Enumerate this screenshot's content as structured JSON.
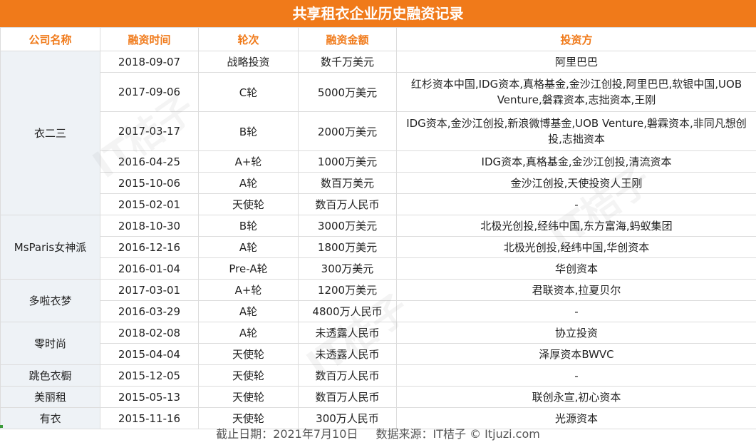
{
  "title": "共享租衣企业历史融资记录",
  "headers": [
    "公司名称",
    "融资时间",
    "轮次",
    "融资金额",
    "投资方"
  ],
  "companies": [
    {
      "name": "衣二三",
      "rows": [
        {
          "date": "2018-09-07",
          "round": "战略投资",
          "amount": "数千万美元",
          "investors": "阿里巴巴"
        },
        {
          "date": "2017-09-06",
          "round": "C轮",
          "amount": "5000万美元",
          "investors": "红杉资本中国,IDG资本,真格基金,金沙江创投,阿里巴巴,软银中国,UOB Venture,磐霖资本,志拙资本,王刚"
        },
        {
          "date": "2017-03-17",
          "round": "B轮",
          "amount": "2000万美元",
          "investors": "IDG资本,金沙江创投,新浪微博基金,UOB Venture,磐霖资本,非同凡想创投,志拙资本"
        },
        {
          "date": "2016-04-25",
          "round": "A+轮",
          "amount": "1000万美元",
          "investors": "IDG资本,真格基金,金沙江创投,清流资本"
        },
        {
          "date": "2015-10-06",
          "round": "A轮",
          "amount": "数百万美元",
          "investors": "金沙江创投,天使投资人王刚"
        },
        {
          "date": "2015-02-01",
          "round": "天使轮",
          "amount": "数百万人民币",
          "investors": "-"
        }
      ]
    },
    {
      "name": "MsParis女神派",
      "rows": [
        {
          "date": "2018-10-30",
          "round": "B轮",
          "amount": "3000万美元",
          "investors": "北极光创投,经纬中国,东方富海,蚂蚁集团"
        },
        {
          "date": "2016-12-16",
          "round": "A轮",
          "amount": "1800万美元",
          "investors": "北极光创投,经纬中国,华创资本"
        },
        {
          "date": "2016-01-04",
          "round": "Pre-A轮",
          "amount": "300万美元",
          "investors": "华创资本"
        }
      ]
    },
    {
      "name": "多啦衣梦",
      "rows": [
        {
          "date": "2017-03-01",
          "round": "A+轮",
          "amount": "1200万美元",
          "investors": "君联资本,拉夏贝尔"
        },
        {
          "date": "2016-03-29",
          "round": "A轮",
          "amount": "4800万人民币",
          "investors": "-"
        }
      ]
    },
    {
      "name": "零时尚",
      "rows": [
        {
          "date": "2018-02-08",
          "round": "A轮",
          "amount": "未透露人民币",
          "investors": "协立投资"
        },
        {
          "date": "2015-04-04",
          "round": "天使轮",
          "amount": "未透露人民币",
          "investors": "泽厚资本BWVC"
        }
      ]
    },
    {
      "name": "跳色衣橱",
      "rows": [
        {
          "date": "2015-12-05",
          "round": "天使轮",
          "amount": "数百万人民币",
          "investors": "-"
        }
      ]
    },
    {
      "name": "美丽租",
      "rows": [
        {
          "date": "2015-05-13",
          "round": "天使轮",
          "amount": "数百万人民币",
          "investors": "联创永宣,初心资本"
        }
      ]
    },
    {
      "name": "有衣",
      "rows": [
        {
          "date": "2015-11-16",
          "round": "天使轮",
          "amount": "300万人民币",
          "investors": "光源资本"
        }
      ]
    }
  ],
  "footer": {
    "cutoff": "截止日期：2021年7月10日",
    "source": "数据来源：IT桔子 © Itjuzi.com"
  },
  "watermark": "IT桔子",
  "colors": {
    "accent": "#f07a1a",
    "company_bg": "#eef2f6",
    "border": "#dcdcdc"
  }
}
